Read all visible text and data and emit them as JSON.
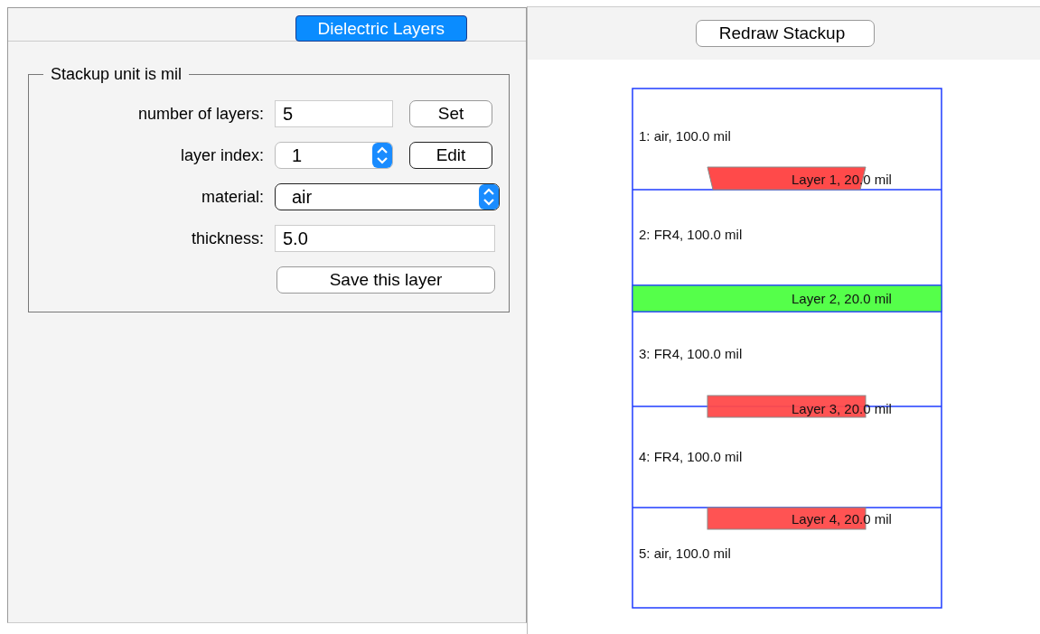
{
  "tabs": [
    {
      "label": "Dielectric Layers",
      "selected": true
    }
  ],
  "panel": {
    "title": "Stackup unit is mil",
    "number_of_layers": {
      "label": "number of layers:",
      "value": "5",
      "button": "Set"
    },
    "layer_index": {
      "label": "layer index:",
      "value": "1",
      "button": "Edit"
    },
    "material": {
      "label": "material:",
      "value": "air"
    },
    "thickness": {
      "label": "thickness:",
      "value": "5.0"
    },
    "save_button": "Save this layer"
  },
  "toolbar": {
    "button": "Redraw Stackup"
  },
  "stackup": {
    "dielectrics": [
      {
        "label": "1: air, 100.0 mil"
      },
      {
        "label": "2: FR4, 100.0 mil"
      },
      {
        "label": "3: FR4, 100.0 mil"
      },
      {
        "label": "4: FR4, 100.0 mil"
      },
      {
        "label": "5: air, 100.0 mil"
      }
    ],
    "conductors": [
      {
        "label": "Layer 1, 20.0 mil",
        "kind": "trapezoid",
        "color": "#ff4a4a"
      },
      {
        "label": "Layer 2, 20.0 mil",
        "kind": "plane",
        "color": "#4cff40"
      },
      {
        "label": "Layer 3, 20.0 mil",
        "kind": "trace",
        "color": "#ff4a4a"
      },
      {
        "label": "Layer 4, 20.0 mil",
        "kind": "trace",
        "color": "#ff4a4a"
      }
    ]
  }
}
